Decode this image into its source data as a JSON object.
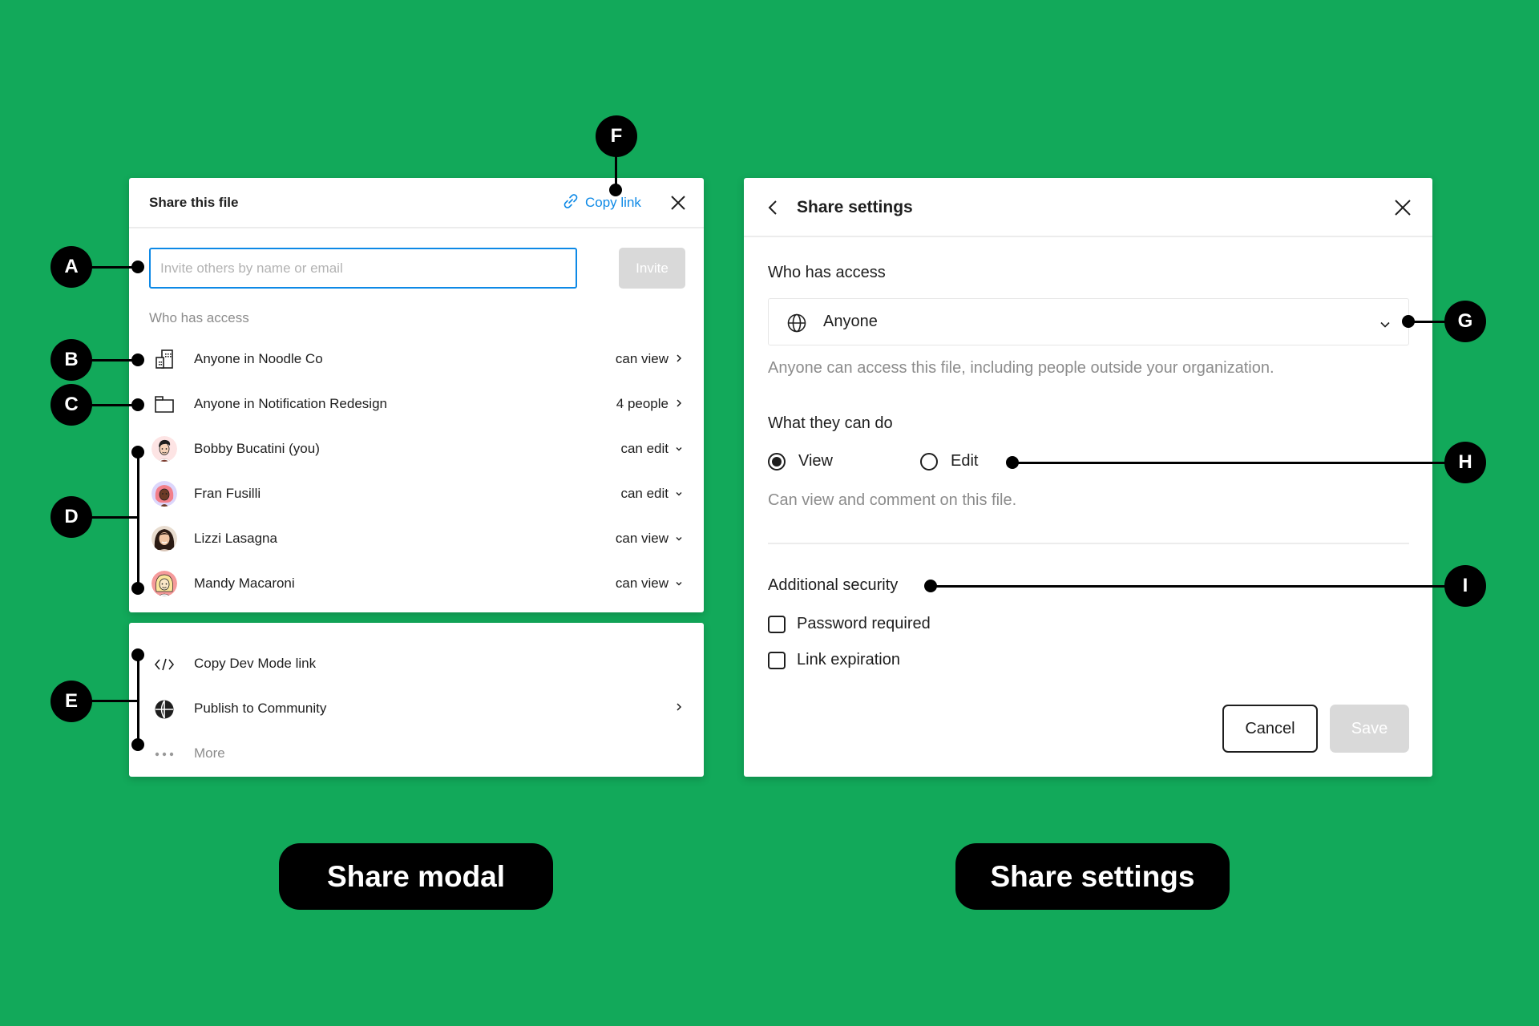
{
  "share_modal": {
    "title": "Share this file",
    "copy_link_label": "Copy link",
    "close_icon": "close-icon",
    "invite_input": {
      "value": "",
      "placeholder": "Invite others by name or email"
    },
    "invite_button": "Invite",
    "who_has_access_label": "Who has access",
    "access_rows": [
      {
        "icon": "building-icon",
        "name": "Anyone in Noodle Co",
        "permission": "can view",
        "indicator": "chevron-right"
      },
      {
        "icon": "folder-icon",
        "name": "Anyone in Notification Redesign",
        "permission": "4 people",
        "indicator": "chevron-right"
      },
      {
        "icon": "avatar",
        "name": "Bobby Bucatini (you)",
        "permission": "can edit",
        "indicator": "chevron-down"
      },
      {
        "icon": "avatar",
        "name": "Fran Fusilli",
        "permission": "can edit",
        "indicator": "chevron-down"
      },
      {
        "icon": "avatar",
        "name": "Lizzi Lasagna",
        "permission": "can view",
        "indicator": "chevron-down"
      },
      {
        "icon": "avatar",
        "name": "Mandy Macaroni",
        "permission": "can view",
        "indicator": "chevron-down"
      }
    ],
    "more_rows": [
      {
        "icon": "code-icon",
        "name": "Copy Dev Mode link"
      },
      {
        "icon": "community-globe-icon",
        "name": "Publish to Community",
        "indicator": "chevron-right"
      },
      {
        "icon": "more-dots-icon",
        "name": "More"
      }
    ]
  },
  "share_settings": {
    "title": "Share settings",
    "who_has_access": {
      "heading": "Who has access",
      "selected": "Anyone",
      "help": "Anyone can access this file, including people outside your organization."
    },
    "what_they_can_do": {
      "heading": "What they can do",
      "options": [
        {
          "label": "View",
          "selected": true
        },
        {
          "label": "Edit",
          "selected": false
        }
      ],
      "help": "Can view and comment on this file."
    },
    "additional_security": {
      "heading": "Additional security",
      "options": [
        {
          "label": "Password required",
          "checked": false
        },
        {
          "label": "Link expiration",
          "checked": false
        }
      ]
    },
    "cancel_button": "Cancel",
    "save_button": "Save"
  },
  "callouts": [
    "A",
    "B",
    "C",
    "D",
    "E",
    "F",
    "G",
    "H",
    "I"
  ],
  "captions": {
    "left": "Share modal",
    "right": "Share settings"
  },
  "colors": {
    "background": "#12a95a",
    "accent": "#0d89e6",
    "disabled": "#d9d9d9",
    "muted_text": "#8c8c8c"
  }
}
